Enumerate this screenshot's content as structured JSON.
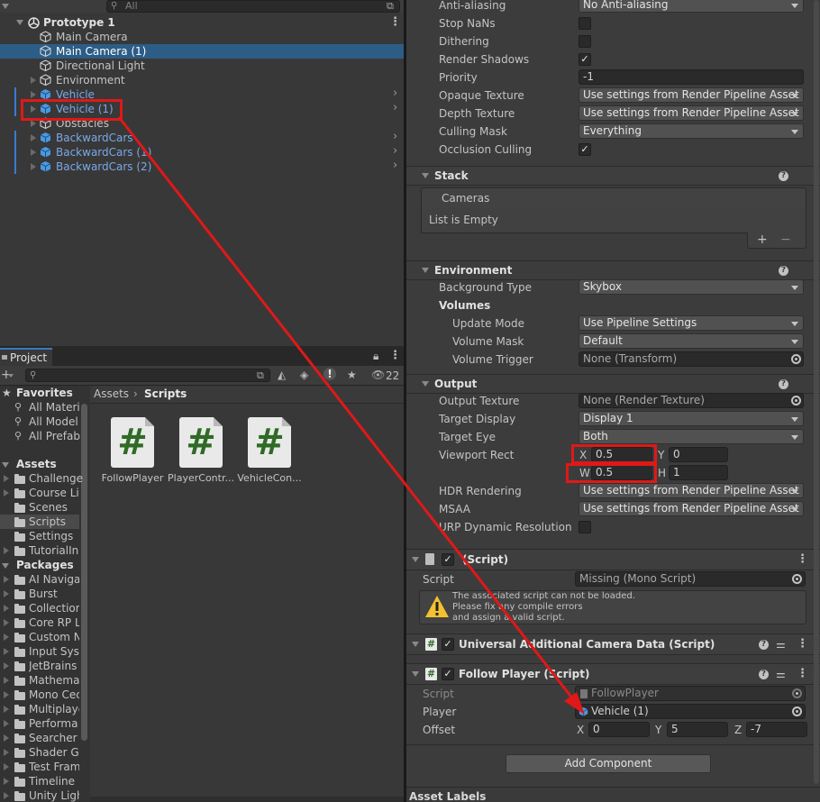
{
  "hierarchy": {
    "search_placeholder": "All",
    "scene_name": "Prototype 1",
    "items": [
      {
        "label": "Main Camera",
        "color": "normal"
      },
      {
        "label": "Main Camera (1)",
        "color": "normal",
        "selected": true
      },
      {
        "label": "Directional Light",
        "color": "normal"
      },
      {
        "label": "Environment",
        "color": "normal"
      },
      {
        "label": "Vehicle",
        "color": "blue"
      },
      {
        "label": "Vehicle (1)",
        "color": "blue"
      },
      {
        "label": "Obstacles",
        "color": "normal"
      },
      {
        "label": "BackwardCars",
        "color": "blue"
      },
      {
        "label": "BackwardCars (1)",
        "color": "blue"
      },
      {
        "label": "BackwardCars (2)",
        "color": "blue"
      }
    ]
  },
  "project": {
    "tab_label": "Project",
    "hidden_count": "22",
    "breadcrumb": {
      "root": "Assets",
      "current": "Scripts"
    },
    "favorites_label": "Favorites",
    "favorites": [
      "All Materi",
      "All Model",
      "All Prefab"
    ],
    "assets_label": "Assets",
    "assets_folders": [
      "Challenge",
      "Course Li",
      "Scenes",
      "Scripts",
      "Settings",
      "TutorialIn"
    ],
    "packages_label": "Packages",
    "packages_folders": [
      "AI Naviga",
      "Burst",
      "Collection",
      "Core RP L",
      "Custom N",
      "Input Sys",
      "JetBrains",
      "Mathema",
      "Mono Cec",
      "Multiplaye",
      "Performa",
      "Searcher",
      "Shader G",
      "Test Fram",
      "Timeline",
      "Unity Ligh"
    ],
    "files": [
      "FollowPlayer",
      "PlayerContr...",
      "VehicleCon..."
    ]
  },
  "inspector": {
    "rendering": [
      {
        "label": "Anti-aliasing",
        "type": "dropdown",
        "value": "No Anti-aliasing"
      },
      {
        "label": "Stop NaNs",
        "type": "checkbox",
        "value": ""
      },
      {
        "label": "Dithering",
        "type": "checkbox",
        "value": ""
      },
      {
        "label": "Render Shadows",
        "type": "checkbox",
        "value": "✓"
      },
      {
        "label": "Priority",
        "type": "field",
        "value": "-1"
      },
      {
        "label": "Opaque Texture",
        "type": "dropdown",
        "value": "Use settings from Render Pipeline Asset"
      },
      {
        "label": "Depth Texture",
        "type": "dropdown",
        "value": "Use settings from Render Pipeline Asset"
      },
      {
        "label": "Culling Mask",
        "type": "dropdown",
        "value": "Everything"
      },
      {
        "label": "Occlusion Culling",
        "type": "checkbox",
        "value": "✓"
      }
    ],
    "stack": {
      "title": "Stack",
      "list_header": "Cameras",
      "empty_text": "List is Empty",
      "add": "+",
      "remove": "−"
    },
    "environment": {
      "title": "Environment",
      "background_type_label": "Background Type",
      "background_type_value": "Skybox",
      "volumes_label": "Volumes",
      "update_mode_label": "Update Mode",
      "update_mode_value": "Use Pipeline Settings",
      "volume_mask_label": "Volume Mask",
      "volume_mask_value": "Default",
      "volume_trigger_label": "Volume Trigger",
      "volume_trigger_value": "None (Transform)"
    },
    "output": {
      "title": "Output",
      "output_texture_label": "Output Texture",
      "output_texture_value": "None (Render Texture)",
      "target_display_label": "Target Display",
      "target_display_value": "Display 1",
      "target_eye_label": "Target Eye",
      "target_eye_value": "Both",
      "viewport_label": "Viewport Rect",
      "vx_label": "X",
      "vx": "0.5",
      "vy_label": "Y",
      "vy": "0",
      "vw_label": "W",
      "vw": "0.5",
      "vh_label": "H",
      "vh": "1",
      "hdr_label": "HDR Rendering",
      "hdr_value": "Use settings from Render Pipeline Asset",
      "msaa_label": "MSAA",
      "msaa_value": "Use settings from Render Pipeline Asset",
      "urp_label": "URP Dynamic Resolution"
    },
    "missing_script": {
      "title": "(Script)",
      "script_label": "Script",
      "script_value": "Missing (Mono Script)",
      "warning_lines": [
        "The associated script can not be loaded.",
        "Please fix any compile errors",
        "and assign a valid script."
      ]
    },
    "additional_camera": {
      "title": "Universal Additional Camera Data (Script)"
    },
    "follow_player": {
      "title": "Follow Player (Script)",
      "script_label": "Script",
      "script_value": "FollowPlayer",
      "player_label": "Player",
      "player_value": "Vehicle (1)",
      "offset_label": "Offset",
      "ox_label": "X",
      "ox": "0",
      "oy_label": "Y",
      "oy": "5",
      "oz_label": "Z",
      "oz": "-7"
    },
    "add_component": "Add Component",
    "asset_labels": "Asset Labels"
  },
  "colors": {
    "accent_red": "#e01818",
    "selection_blue": "#2c5d87",
    "prefab_blue": "#7aa8e8"
  }
}
